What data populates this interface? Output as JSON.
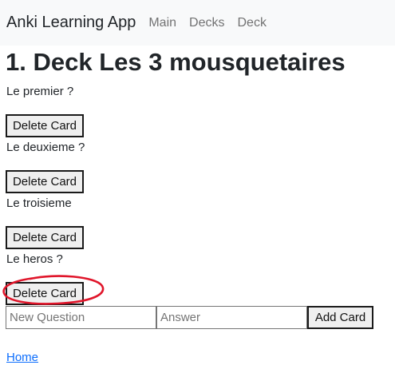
{
  "navbar": {
    "brand": "Anki Learning App",
    "links": [
      "Main",
      "Decks",
      "Deck"
    ]
  },
  "page_title": "1. Deck Les 3 mousquetaires",
  "cards": [
    {
      "question": "Le premier ?",
      "delete_label": "Delete Card"
    },
    {
      "question": "Le deuxieme ?",
      "delete_label": "Delete Card"
    },
    {
      "question": "Le troisieme",
      "delete_label": "Delete Card"
    },
    {
      "question": "Le heros ?",
      "delete_label": "Delete Card"
    }
  ],
  "new_card": {
    "question_placeholder": "New Question",
    "answer_placeholder": "Answer",
    "add_label": "Add Card"
  },
  "footer": {
    "home_link": "Home"
  },
  "colors": {
    "navbar_bg": "#f8f9fa",
    "link": "#0d6efd",
    "annotation": "#e0152a"
  }
}
